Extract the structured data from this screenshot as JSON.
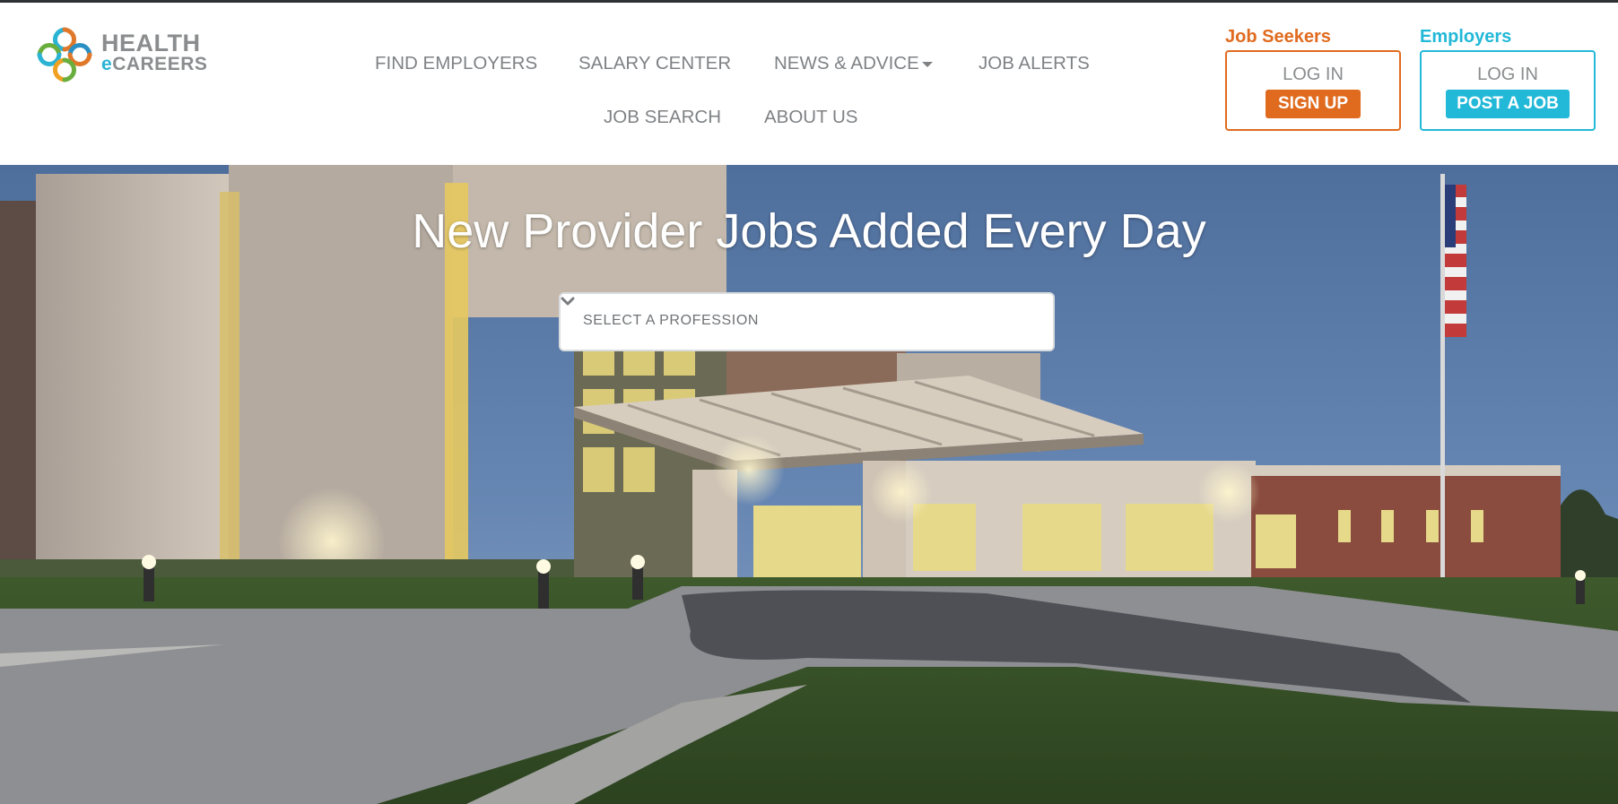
{
  "logo": {
    "line1": "HEALTH",
    "line2_e": "e",
    "line2_rest": "CAREERS"
  },
  "nav": {
    "row1": [
      "FIND EMPLOYERS",
      "SALARY CENTER",
      "NEWS & ADVICE",
      "JOB ALERTS"
    ],
    "row2": [
      "JOB SEARCH",
      "ABOUT US"
    ]
  },
  "job_seekers": {
    "title": "Job Seekers",
    "login": "LOG IN",
    "button": "SIGN UP",
    "color": "#e06b1f"
  },
  "employers": {
    "title": "Employers",
    "login": "LOG IN",
    "button": "POST A JOB",
    "color": "#22b8d8"
  },
  "hero": {
    "title": "New Provider Jobs Added Every Day",
    "select_placeholder": "SELECT A PROFESSION"
  },
  "icons": {
    "logo": "health-ecareers-logo-icon",
    "dropdown": "chevron-down-icon",
    "nav_caret": "caret-down-icon"
  }
}
